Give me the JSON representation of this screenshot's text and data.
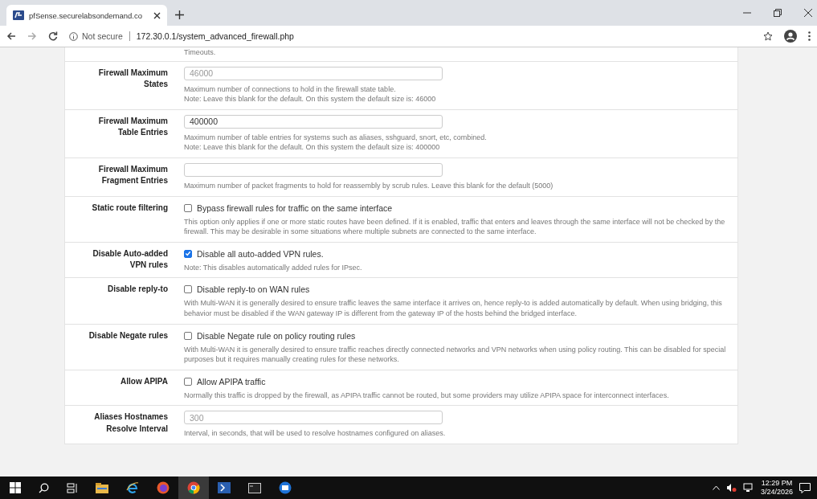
{
  "browser": {
    "tab": {
      "title": "pfSense.securelabsondemand.co"
    },
    "address": {
      "security": "Not secure",
      "url": "172.30.0.1/system_advanced_firewall.php"
    }
  },
  "settings": [
    {
      "kind": "text",
      "description": [
        "Timeouts."
      ]
    },
    {
      "kind": "input",
      "label": "Firewall Maximum States",
      "placeholder": "46000",
      "description": [
        "Maximum number of connections to hold in the firewall state table.",
        "Note: Leave this blank for the default. On this system the default size is: 46000"
      ]
    },
    {
      "kind": "input",
      "label": "Firewall Maximum Table Entries",
      "value": "400000",
      "description": [
        "Maximum number of table entries for systems such as aliases, sshguard, snort, etc, combined.",
        "Note: Leave this blank for the default. On this system the default size is: 400000"
      ]
    },
    {
      "kind": "input",
      "label": "Firewall Maximum Fragment Entries",
      "description": [
        "Maximum number of packet fragments to hold for reassembly by scrub rules. Leave this blank for the default (5000)"
      ]
    },
    {
      "kind": "checkbox",
      "label": "Static route filtering",
      "checked": false,
      "option": "Bypass firewall rules for traffic on the same interface",
      "description": [
        "This option only applies if one or more static routes have been defined. If it is enabled, traffic that enters and leaves through the same interface will not be checked by the firewall. This may be desirable in some situations where multiple subnets are connected to the same interface."
      ]
    },
    {
      "kind": "checkbox",
      "label": "Disable Auto-added VPN rules",
      "checked": true,
      "option": "Disable all auto-added VPN rules.",
      "description": [
        "Note: This disables automatically added rules for IPsec."
      ]
    },
    {
      "kind": "checkbox",
      "label": "Disable reply-to",
      "checked": false,
      "option": "Disable reply-to on WAN rules",
      "description": [
        "With Multi-WAN it is generally desired to ensure traffic leaves the same interface it arrives on, hence reply-to is added automatically by default. When using bridging, this behavior must be disabled if the WAN gateway IP is different from the gateway IP of the hosts behind the bridged interface."
      ]
    },
    {
      "kind": "checkbox",
      "label": "Disable Negate rules",
      "checked": false,
      "option": "Disable Negate rule on policy routing rules",
      "description": [
        "With Multi-WAN it is generally desired to ensure traffic reaches directly connected networks and VPN networks when using policy routing. This can be disabled for special purposes but it requires manually creating rules for these networks."
      ]
    },
    {
      "kind": "checkbox",
      "label": "Allow APIPA",
      "checked": false,
      "option": "Allow APIPA traffic",
      "description": [
        "Normally this traffic is dropped by the firewall, as APIPA traffic cannot be routed, but some providers may utilize APIPA space for interconnect interfaces."
      ]
    },
    {
      "kind": "input",
      "label": "Aliases Hostnames Resolve Interval",
      "placeholder": "300",
      "description": [
        "Interval, in seconds, that will be used to resolve hostnames configured on aliases."
      ]
    }
  ],
  "taskbar": {
    "time": "12:29 PM",
    "date": "3/24/2026"
  }
}
